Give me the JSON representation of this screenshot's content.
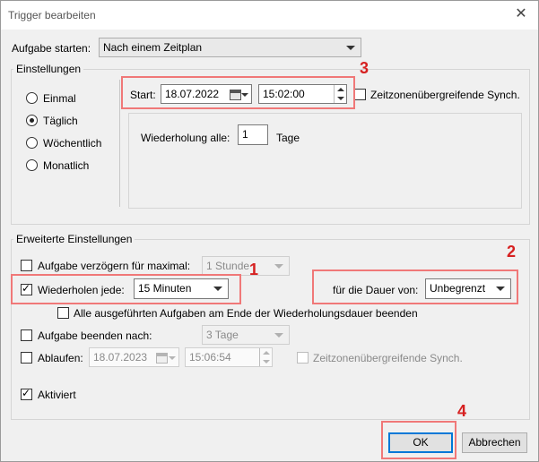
{
  "window": {
    "title": "Trigger bearbeiten",
    "close_glyph": "✕"
  },
  "aufgabe_starten": {
    "label": "Aufgabe starten:",
    "value": "Nach einem Zeitplan"
  },
  "einstellungen": {
    "group_title": "Einstellungen",
    "schedule_options": [
      {
        "label": "Einmal",
        "selected": false
      },
      {
        "label": "Täglich",
        "selected": true
      },
      {
        "label": "Wöchentlich",
        "selected": false
      },
      {
        "label": "Monatlich",
        "selected": false
      }
    ],
    "start_label": "Start:",
    "start_date": "18.07.2022",
    "start_time": "15:02:00",
    "sync_label": "Zeitzonenübergreifende Synch.",
    "sync_checked": false,
    "repeat_label": "Wiederholung alle:",
    "repeat_value": "1",
    "repeat_unit": "Tage"
  },
  "erweitert": {
    "group_title": "Erweiterte Einstellungen",
    "delay_label": "Aufgabe verzögern für maximal:",
    "delay_checked": false,
    "delay_value": "1 Stunde",
    "repeat_label": "Wiederholen jede:",
    "repeat_checked": true,
    "repeat_value": "15 Minuten",
    "duration_label": "für die Dauer von:",
    "duration_value": "Unbegrenzt",
    "end_all_label": "Alle ausgeführten Aufgaben am Ende der Wiederholungsdauer beenden",
    "end_all_checked": false,
    "stop_label": "Aufgabe beenden nach:",
    "stop_checked": false,
    "stop_value": "3 Tage",
    "expire_label": "Ablaufen:",
    "expire_checked": false,
    "expire_date": "18.07.2023",
    "expire_time": "15:06:54",
    "expire_sync_label": "Zeitzonenübergreifende Synch.",
    "enabled_label": "Aktiviert",
    "enabled_checked": true
  },
  "buttons": {
    "ok": "OK",
    "cancel": "Abbrechen"
  },
  "annotations": [
    "1",
    "2",
    "3",
    "4"
  ],
  "colors": {
    "highlight": "#f07878",
    "annotation_number": "#d62020",
    "default_button_border": "#0078d7"
  }
}
